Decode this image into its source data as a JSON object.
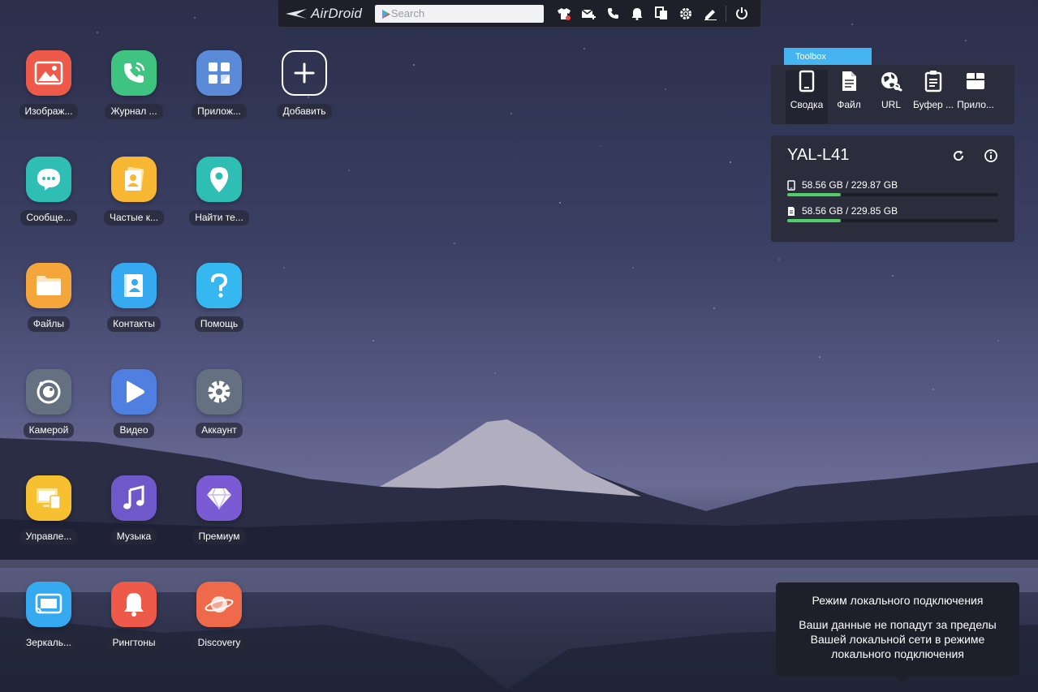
{
  "topbar": {
    "logo_text": "AirDroid",
    "search_placeholder": "Search",
    "icons": [
      "tshirt-icon",
      "mail-plus-icon",
      "phone-icon",
      "bell-icon",
      "copy-icon",
      "gear-icon",
      "pen-icon",
      "power-icon"
    ]
  },
  "apps": [
    {
      "label": "Изображ...",
      "icon": "image-icon",
      "color": "#ee5a4a"
    },
    {
      "label": "Журнал ...",
      "icon": "phone-call-icon",
      "color": "#3fc380"
    },
    {
      "label": "Прилож...",
      "icon": "apps-grid-icon",
      "color": "#5b8ad8"
    },
    {
      "label": "Добавить",
      "icon": "plus-icon",
      "color": "transparent"
    },
    {
      "label": "Сообще...",
      "icon": "message-icon",
      "color": "#2ebeb4"
    },
    {
      "label": "Частые к...",
      "icon": "contacts-card-icon",
      "color": "#f7b733"
    },
    {
      "label": "Найти те...",
      "icon": "location-pin-icon",
      "color": "#2ebeb4"
    },
    {
      "label": "Файлы",
      "icon": "folder-icon",
      "color": "#f5a63a"
    },
    {
      "label": "Контакты",
      "icon": "address-book-icon",
      "color": "#35aaf0"
    },
    {
      "label": "Помощь",
      "icon": "question-icon",
      "color": "#35b8f0"
    },
    {
      "label": "Камерой",
      "icon": "camera-icon",
      "color": "#657080"
    },
    {
      "label": "Видео",
      "icon": "play-icon",
      "color": "#4f7fe0"
    },
    {
      "label": "Аккаунт",
      "icon": "gear-icon",
      "color": "#657080"
    },
    {
      "label": "Управле...",
      "icon": "screen-manage-icon",
      "color": "#f7c031"
    },
    {
      "label": "Музыка",
      "icon": "music-icon",
      "color": "#6f58c9"
    },
    {
      "label": "Премиум",
      "icon": "diamond-icon",
      "color": "#7a5bd4"
    },
    {
      "label": "Зеркаль...",
      "icon": "cast-icon",
      "color": "#35aaf0"
    },
    {
      "label": "Рингтоны",
      "icon": "bell-icon",
      "color": "#ee5a4a"
    },
    {
      "label": "Discovery",
      "icon": "planet-icon",
      "color": "#ee6a4a"
    }
  ],
  "toolbox": {
    "tab_label": "Toolbox",
    "tools": [
      {
        "label": "Сводка",
        "icon": "phone-device-icon"
      },
      {
        "label": "Файл",
        "icon": "file-icon"
      },
      {
        "label": "URL",
        "icon": "globe-link-icon"
      },
      {
        "label": "Буфер ...",
        "icon": "clipboard-icon"
      },
      {
        "label": "Прило...",
        "icon": "package-icon"
      }
    ]
  },
  "device": {
    "name": "YAL-L41",
    "storage": [
      {
        "icon": "phone-small-icon",
        "text": "58.56 GB / 229.87 GB",
        "fraction": 0.255
      },
      {
        "icon": "sd-card-icon",
        "text": "58.56 GB / 229.85 GB",
        "fraction": 0.255
      }
    ],
    "bar_color": "#4fce6a"
  },
  "tooltip": {
    "title": "Режим локального подключения",
    "body": "Ваши данные не попадут за пределы Вашей локальной сети в режиме локального подключения"
  }
}
